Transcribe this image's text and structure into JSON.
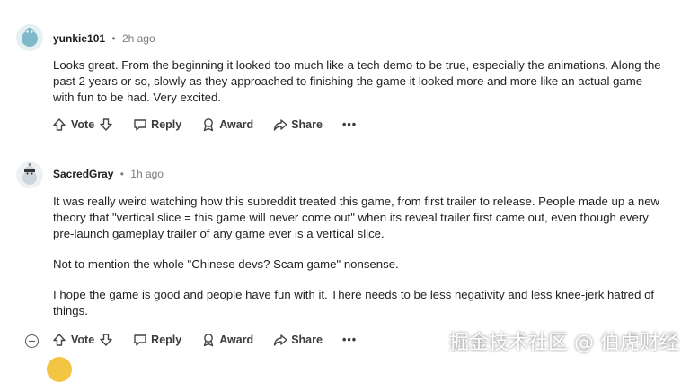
{
  "comments": [
    {
      "author": "yunkie101",
      "time": "2h ago",
      "paragraphs": [
        "Looks great. From the beginning it looked too much like a tech demo to be true, especially the animations. Along the past 2 years or so, slowly as they approached to finishing the game it looked more and more like an actual game with fun to be had. Very excited."
      ],
      "actions": {
        "vote": "Vote",
        "reply": "Reply",
        "award": "Award",
        "share": "Share",
        "more": "•••"
      }
    },
    {
      "author": "SacredGray",
      "time": "1h ago",
      "paragraphs": [
        "It was really weird watching how this subreddit treated this game, from first trailer to release. People made up a new theory that \"vertical slice = this game will never come out\" when its reveal trailer first came out, even though every pre-launch gameplay trailer of any game ever is a vertical slice.",
        "Not to mention the whole \"Chinese devs? Scam game\" nonsense.",
        "I hope the game is good and people have fun with it. There needs to be less negativity and less knee-jerk hatred of things."
      ],
      "actions": {
        "vote": "Vote",
        "reply": "Reply",
        "award": "Award",
        "share": "Share",
        "more": "•••"
      }
    }
  ],
  "separator": "•",
  "watermark": "掘金技术社区 @ 伯虎财经",
  "icons": {
    "avatar_1": "snoo-avatar-icon",
    "avatar_2": "snoo-avatar-icon",
    "upvote": "arrow-up-icon",
    "downvote": "arrow-down-icon",
    "reply": "speech-bubble-icon",
    "award": "award-icon",
    "share": "share-arrow-icon",
    "collapse": "collapse-thread-icon"
  },
  "colors": {
    "avatar_1": "#7fb8c9",
    "avatar_2": "#cfd5dc",
    "text": "#1c1c1c",
    "meta": "#7c7c7c"
  }
}
